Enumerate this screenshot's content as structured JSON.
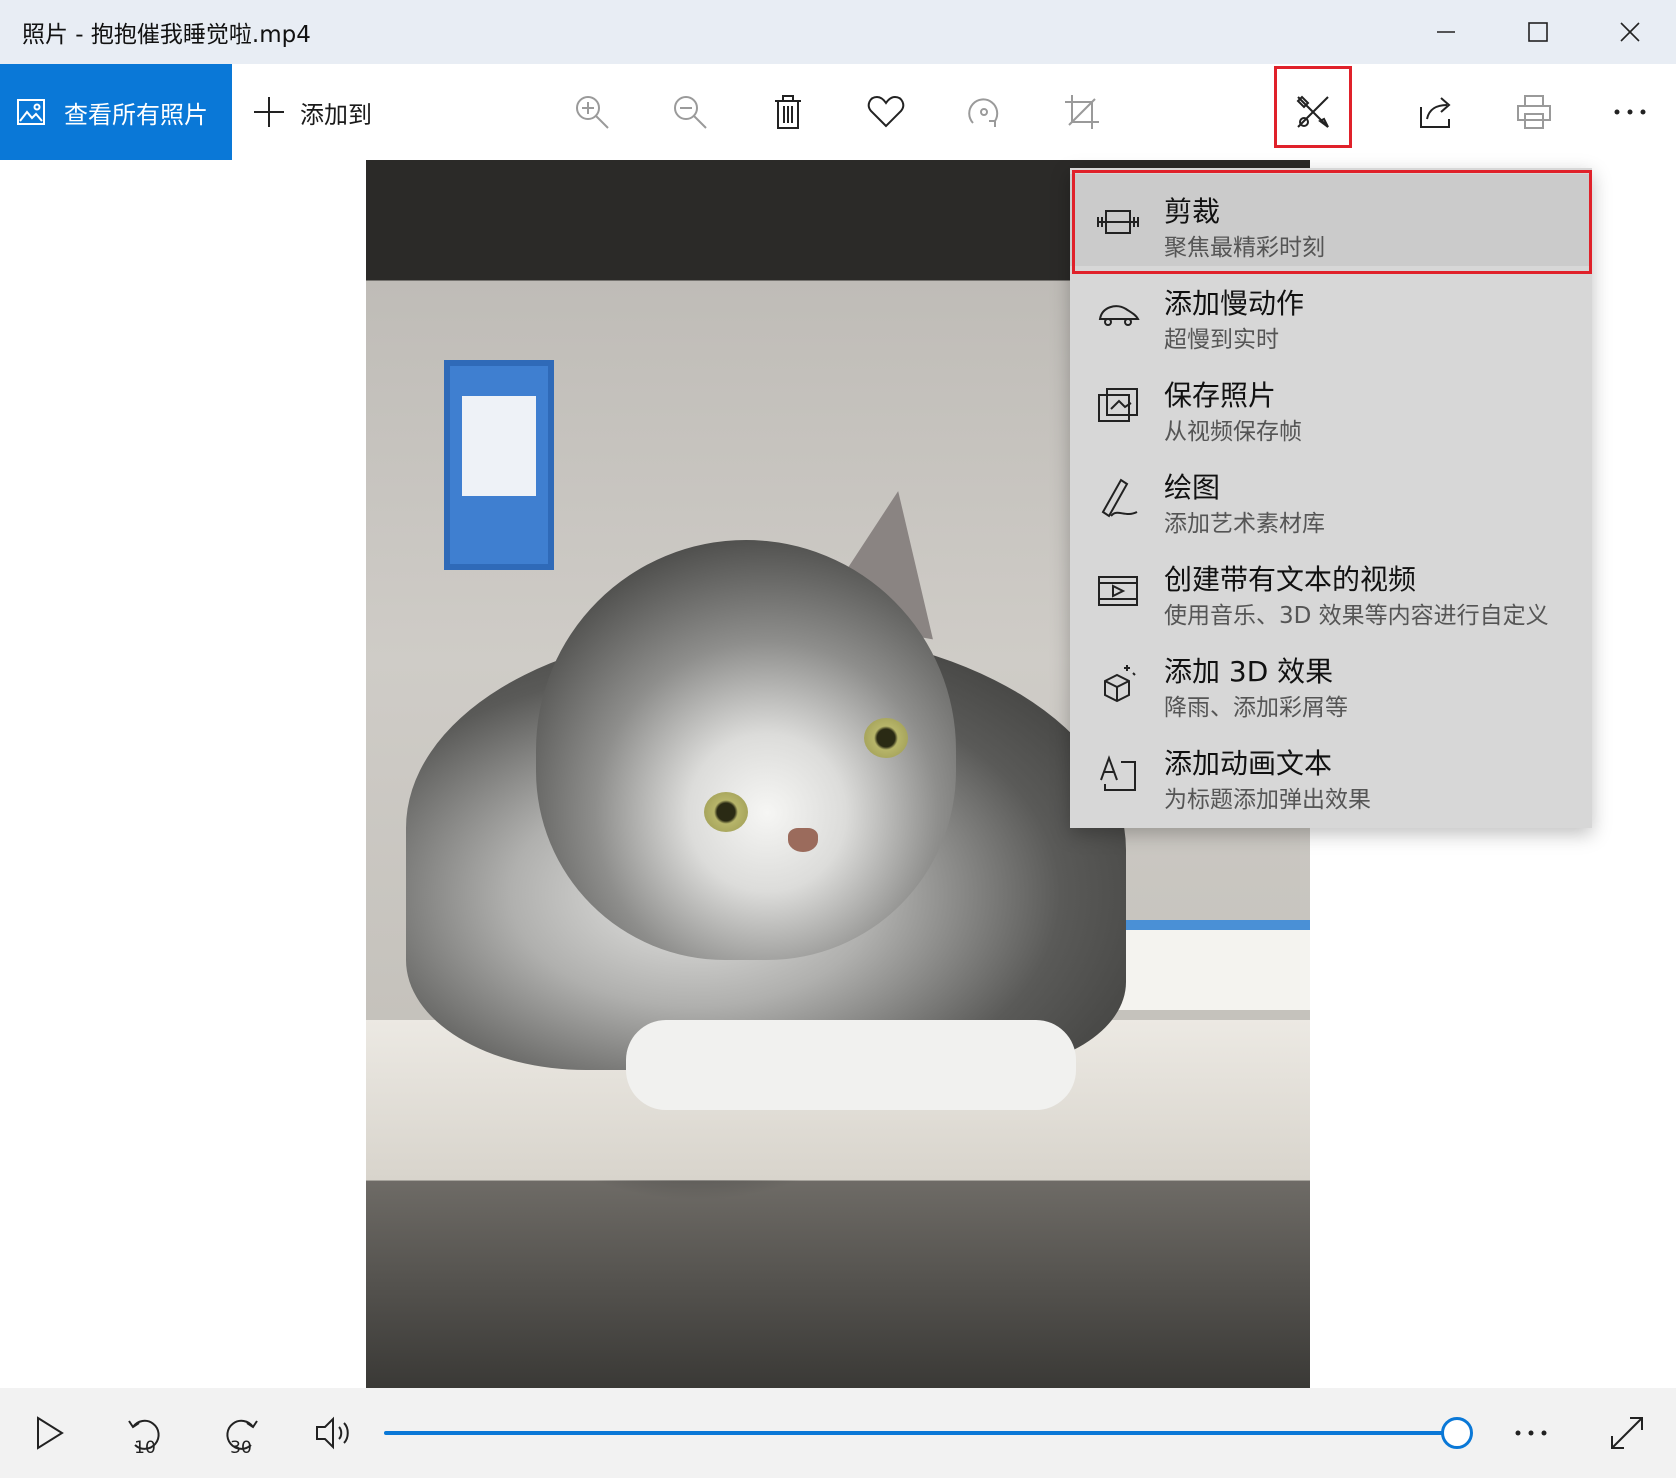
{
  "window": {
    "title": "照片 - 抱抱催我睡觉啦.mp4",
    "controls": [
      "minimize-icon",
      "maximize-icon",
      "close-icon"
    ]
  },
  "toolbar": {
    "view_all_label": "查看所有照片",
    "add_to_label": "添加到",
    "buttons": [
      "zoom-in-icon",
      "zoom-out-icon",
      "delete-icon",
      "favorite-icon",
      "rotate-icon",
      "crop-icon",
      "edit-create-icon",
      "share-icon",
      "print-icon",
      "more-icon"
    ],
    "accent_color": "#0a78d7",
    "highlight_color": "#e0212a"
  },
  "menu": {
    "items": [
      {
        "icon": "trim-icon",
        "title": "剪裁",
        "subtitle": "聚焦最精彩时刻"
      },
      {
        "icon": "slow-motion-icon",
        "title": "添加慢动作",
        "subtitle": "超慢到实时"
      },
      {
        "icon": "save-photo-icon",
        "title": "保存照片",
        "subtitle": "从视频保存帧"
      },
      {
        "icon": "draw-icon",
        "title": "绘图",
        "subtitle": "添加艺术素材库"
      },
      {
        "icon": "video-with-text-icon",
        "title": "创建带有文本的视频",
        "subtitle": "使用音乐、3D 效果等内容进行自定义"
      },
      {
        "icon": "3d-effects-icon",
        "title": "添加 3D 效果",
        "subtitle": "降雨、添加彩屑等"
      },
      {
        "icon": "animated-text-icon",
        "title": "添加动画文本",
        "subtitle": "为标题添加弹出效果"
      }
    ]
  },
  "playback": {
    "skip_back_label": "10",
    "skip_forward_label": "30",
    "progress": 0.99
  }
}
